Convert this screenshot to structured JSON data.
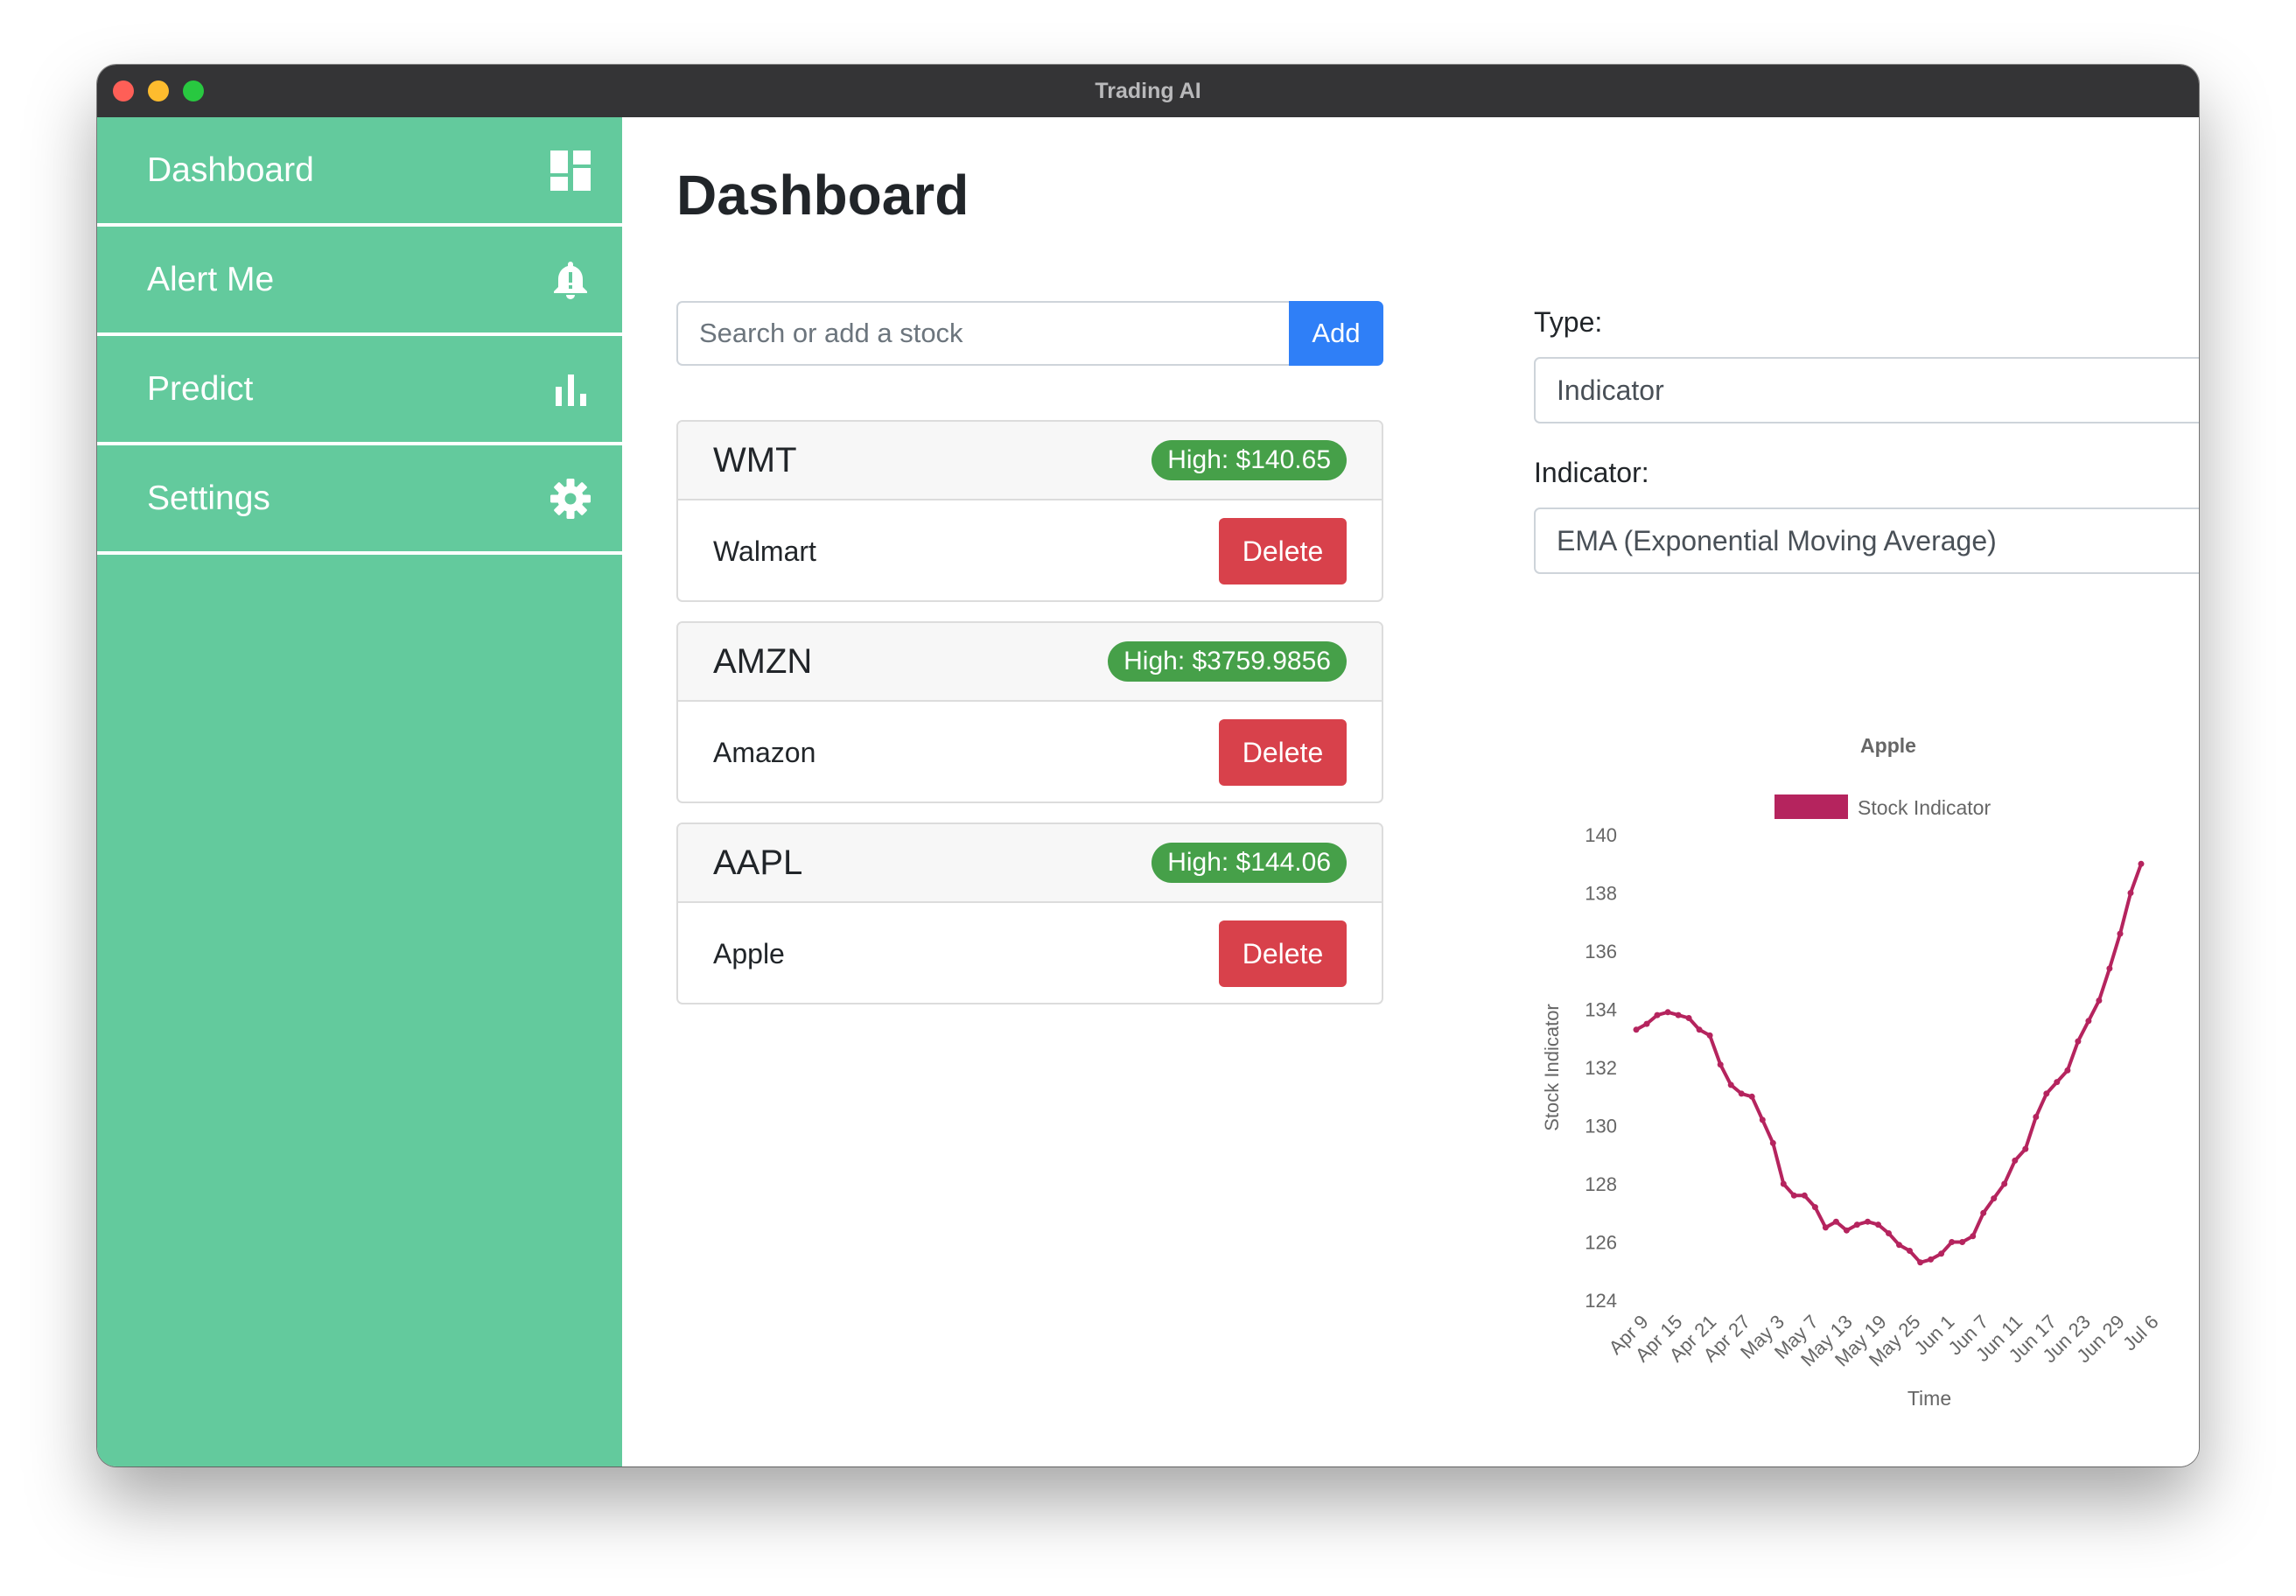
{
  "window": {
    "title": "Trading AI"
  },
  "sidebar": {
    "items": [
      {
        "label": "Dashboard",
        "icon": "dashboard-icon"
      },
      {
        "label": "Alert Me",
        "icon": "bell-icon"
      },
      {
        "label": "Predict",
        "icon": "bar-chart-icon"
      },
      {
        "label": "Settings",
        "icon": "gear-icon"
      }
    ]
  },
  "main": {
    "title": "Dashboard",
    "search": {
      "placeholder": "Search or add a stock",
      "value": "",
      "add_label": "Add"
    },
    "stocks": [
      {
        "ticker": "WMT",
        "high": "High: $140.65",
        "name": "Walmart",
        "delete_label": "Delete"
      },
      {
        "ticker": "AMZN",
        "high": "High: $3759.9856",
        "name": "Amazon",
        "delete_label": "Delete"
      },
      {
        "ticker": "AAPL",
        "high": "High: $144.06",
        "name": "Apple",
        "delete_label": "Delete"
      }
    ],
    "type_label": "Type:",
    "type_value": "Indicator",
    "indicator_label": "Indicator:",
    "indicator_value": "EMA (Exponential Moving Average)"
  },
  "colors": {
    "sidebar": "#63ca9d",
    "accent": "#2f7ff7",
    "danger": "#d8414b",
    "badge": "#46a049",
    "series": "#b5245e"
  },
  "chart_data": {
    "type": "line",
    "title": "Apple",
    "xlabel": "Time",
    "ylabel": "Stock Indicator",
    "legend": "top",
    "grid": false,
    "ylim": [
      124,
      140
    ],
    "yticks": [
      124,
      126,
      128,
      130,
      132,
      134,
      136,
      138,
      140
    ],
    "x_ticks": [
      "Apr 9",
      "Apr 15",
      "Apr 21",
      "Apr 27",
      "May 3",
      "May 7",
      "May 13",
      "May 19",
      "May 25",
      "Jun 1",
      "Jun 7",
      "Jun 11",
      "Jun 17",
      "Jun 23",
      "Jun 29",
      "Jul 6"
    ],
    "series": [
      {
        "name": "Stock Indicator",
        "values": [
          133.3,
          133.5,
          133.8,
          133.9,
          133.8,
          133.7,
          133.3,
          133.1,
          132.1,
          131.4,
          131.1,
          131.0,
          130.2,
          129.4,
          128.0,
          127.6,
          127.6,
          127.2,
          126.5,
          126.7,
          126.4,
          126.6,
          126.7,
          126.6,
          126.3,
          125.9,
          125.7,
          125.3,
          125.4,
          125.6,
          126.0,
          126.0,
          126.2,
          127.0,
          127.5,
          128.0,
          128.8,
          129.2,
          130.3,
          131.1,
          131.5,
          131.9,
          132.9,
          133.6,
          134.3,
          135.4,
          136.6,
          138.0,
          139.0
        ]
      }
    ]
  }
}
